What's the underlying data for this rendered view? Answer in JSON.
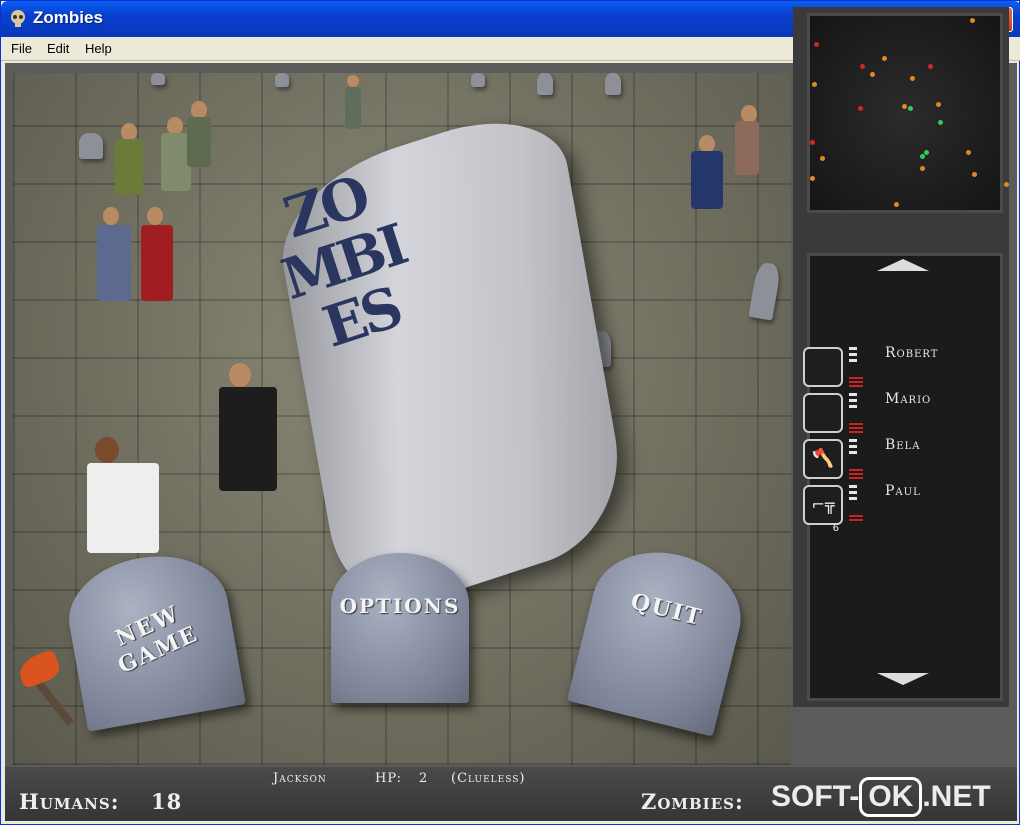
{
  "window": {
    "title": "Zombies"
  },
  "menu": {
    "items": [
      "File",
      "Edit",
      "Help"
    ]
  },
  "tombstones": {
    "new_game": "NEW GAME",
    "options": "OPTIONS",
    "quit": "QUIT"
  },
  "title_stone": {
    "text": "ZOMBIES"
  },
  "roster": {
    "humans": [
      {
        "name": "Robert",
        "item_icon": "",
        "item_count": ""
      },
      {
        "name": "Mario",
        "item_icon": "",
        "item_count": ""
      },
      {
        "name": "Bela",
        "item_icon": "axe-icon",
        "item_count": ""
      },
      {
        "name": "Paul",
        "item_icon": "pistol-icon",
        "item_count": "6"
      }
    ]
  },
  "status": {
    "selected_name": "Jackson",
    "hp_label": "HP:",
    "hp_value": "2",
    "state": "(Clueless)",
    "humans_label": "Humans:",
    "humans_count": "18",
    "zombies_label": "Zombies:"
  },
  "watermark": {
    "left": "SOFT-",
    "box": "OK",
    "right": ".NET"
  },
  "colors": {
    "title_bar": "#0a4fe0",
    "human_dot": "#e08a1e",
    "zombie_dot": "#d2252a",
    "player_dot": "#2fcc5a"
  }
}
